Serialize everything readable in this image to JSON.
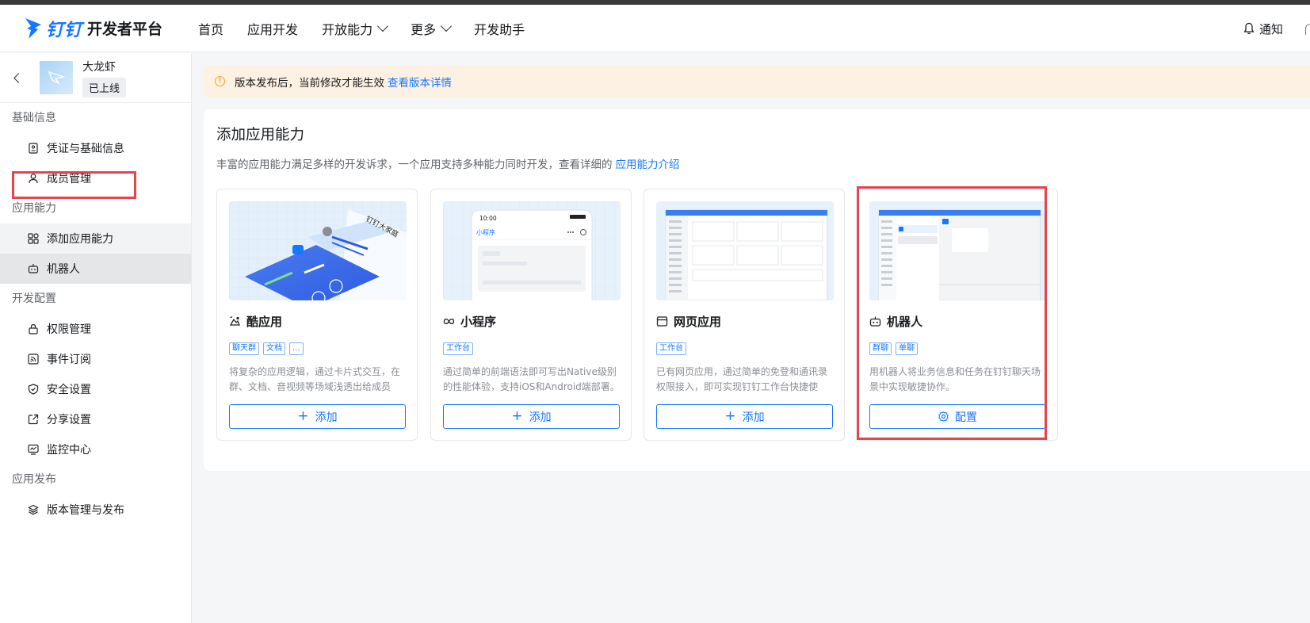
{
  "header": {
    "brand": "钉钉",
    "platform": "开发者平台",
    "nav": [
      {
        "label": "首页",
        "dropdown": false
      },
      {
        "label": "应用开发",
        "dropdown": false
      },
      {
        "label": "开放能力",
        "dropdown": true
      },
      {
        "label": "更多",
        "dropdown": true
      },
      {
        "label": "开发助手",
        "dropdown": false
      }
    ],
    "notify_label": "通知"
  },
  "sidebar": {
    "app_name": "大龙虾",
    "app_status": "已上线",
    "groups": [
      {
        "title": "基础信息",
        "items": [
          {
            "label": "凭证与基础信息",
            "icon": "credential-icon"
          },
          {
            "label": "成员管理",
            "icon": "user-icon"
          }
        ]
      },
      {
        "title": "应用能力",
        "items": [
          {
            "label": "添加应用能力",
            "icon": "apps-icon"
          },
          {
            "label": "机器人",
            "icon": "robot-icon"
          }
        ]
      },
      {
        "title": "开发配置",
        "items": [
          {
            "label": "权限管理",
            "icon": "lock-icon"
          },
          {
            "label": "事件订阅",
            "icon": "rss-icon"
          },
          {
            "label": "安全设置",
            "icon": "shield-icon"
          },
          {
            "label": "分享设置",
            "icon": "share-icon"
          },
          {
            "label": "监控中心",
            "icon": "monitor-icon"
          }
        ]
      },
      {
        "title": "应用发布",
        "items": [
          {
            "label": "版本管理与发布",
            "icon": "layers-icon"
          }
        ]
      }
    ]
  },
  "notice": {
    "text": "版本发布后，当前修改才能生效",
    "link": "查看版本详情"
  },
  "main": {
    "title": "添加应用能力",
    "desc": "丰富的应用能力满足多样的开发诉求，一个应用支持多种能力同时开发，查看详细的",
    "desc_link": "应用能力介绍",
    "cards": [
      {
        "title": "酷应用",
        "icon": "cool-app-icon",
        "tags": [
          "聊天群",
          "文档",
          "..."
        ],
        "desc": "将复杂的应用逻辑，通过卡片式交互，在群、文档、音视频等场域浅透出给成员快...",
        "button": "添加"
      },
      {
        "title": "小程序",
        "icon": "mini-program-icon",
        "tags": [
          "工作台"
        ],
        "desc": "通过简单的前端语法即可写出Native级别的性能体验，支持iOS和Android端部署。",
        "button": "添加"
      },
      {
        "title": "网页应用",
        "icon": "web-app-icon",
        "tags": [
          "工作台"
        ],
        "desc": "已有网页应用，通过简单的免登和通讯录权限接入，即可实现钉钉工作台快捷使用。",
        "button": "添加"
      },
      {
        "title": "机器人",
        "icon": "robot-icon",
        "tags": [
          "群聊",
          "单聊"
        ],
        "desc": "用机器人将业务信息和任务在钉钉聊天场景中实现敏捷协作。",
        "button": "配置"
      }
    ],
    "card_images": {
      "card0_caption": "钉钉大家庭",
      "card1_time": "10:00",
      "card1_title": "小程序"
    }
  },
  "colors": {
    "accent": "#1677ff",
    "highlight": "#e6454d",
    "notice_bg": "#fdf1e3"
  }
}
